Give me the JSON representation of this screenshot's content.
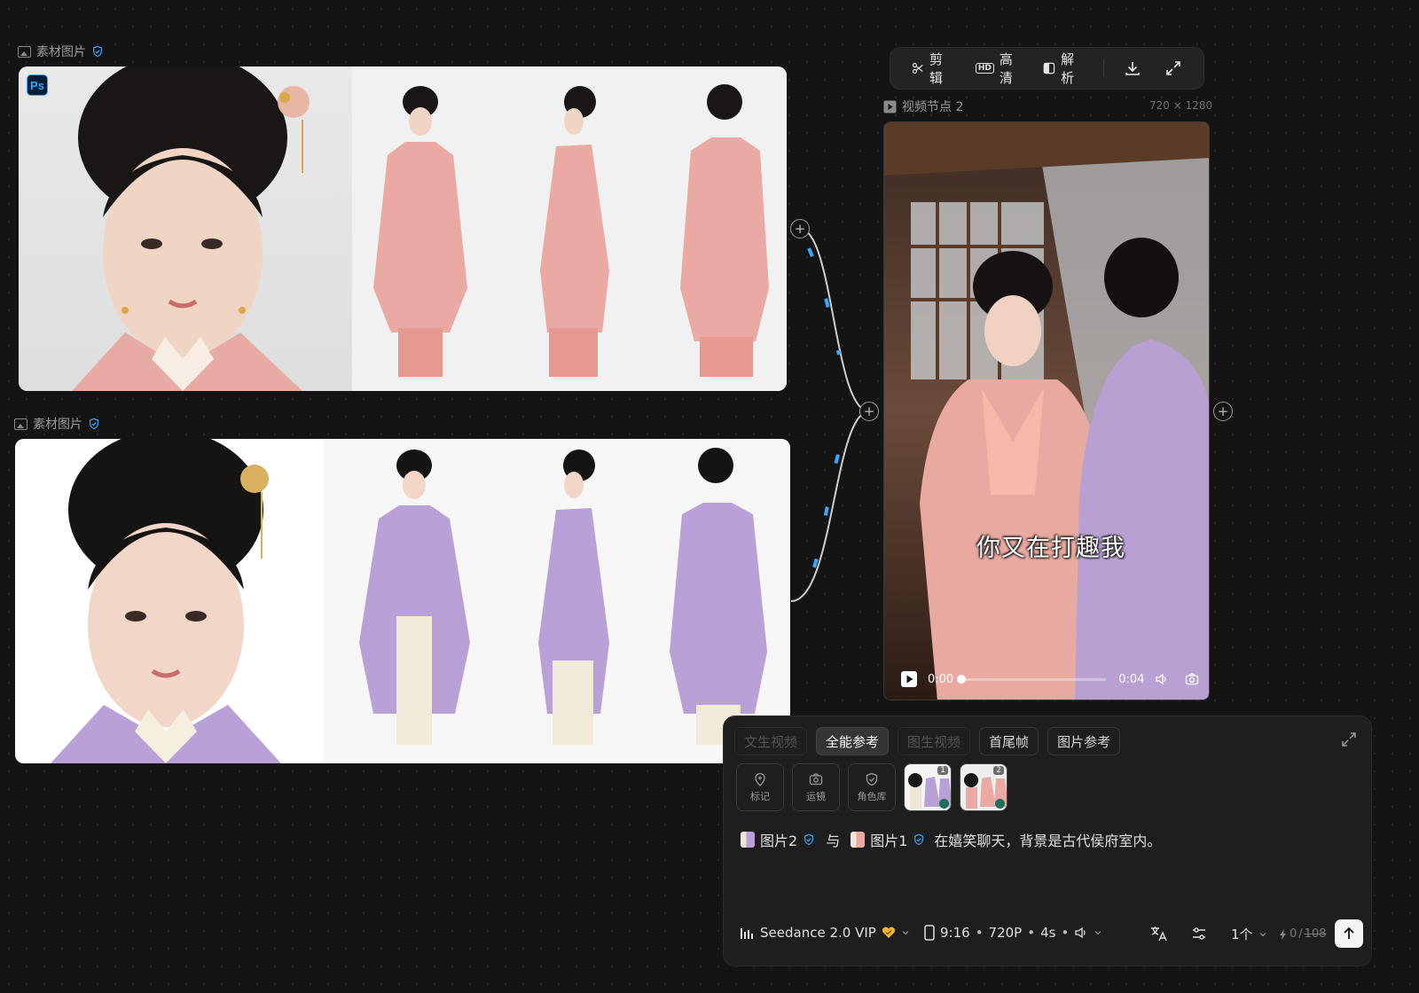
{
  "nodes": {
    "image_node_1": {
      "label": "素材图片",
      "badge": "Ps"
    },
    "image_node_2": {
      "label": "素材图片"
    },
    "video_node": {
      "label": "视频节点 2",
      "resolution": "720 × 1280",
      "subtitle": "你又在打趣我",
      "time_current": "0:00",
      "time_total": "0:04",
      "progress": 0
    }
  },
  "toolbar": {
    "cut_label": "剪辑",
    "hd_label": "高清",
    "hd_icon_text": "HD",
    "analyze_label": "解析"
  },
  "prompt_panel": {
    "tabs": [
      {
        "label": "文生视频",
        "state": "disabled"
      },
      {
        "label": "全能参考",
        "state": "active"
      },
      {
        "label": "图生视频",
        "state": "disabled"
      },
      {
        "label": "首尾帧",
        "state": "normal"
      },
      {
        "label": "图片参考",
        "state": "normal"
      }
    ],
    "tools": [
      {
        "label": "标记",
        "icon": "pin-plus-icon"
      },
      {
        "label": "运镜",
        "icon": "camera-icon"
      },
      {
        "label": "角色库",
        "icon": "shield-check-icon"
      }
    ],
    "reference_thumbs": [
      {
        "number": "1"
      },
      {
        "number": "2"
      }
    ],
    "prompt": {
      "ref_a": "图片2",
      "connector": "与",
      "ref_b": "图片1",
      "text": "在嬉笑聊天，背景是古代侯府室内。"
    },
    "footer": {
      "model": "Seedance 2.0 VIP",
      "ratio": "9:16",
      "quality": "720P",
      "duration": "4s",
      "count": "1个",
      "credits_used": "0",
      "credits_total": "108"
    }
  },
  "colors": {
    "accent_blue": "#3aa8ff",
    "canvas_bg": "#141414",
    "vip_gold": "#f2b632",
    "pink_robe": "#e8a7a0",
    "lavender_robe": "#b39bd0"
  }
}
